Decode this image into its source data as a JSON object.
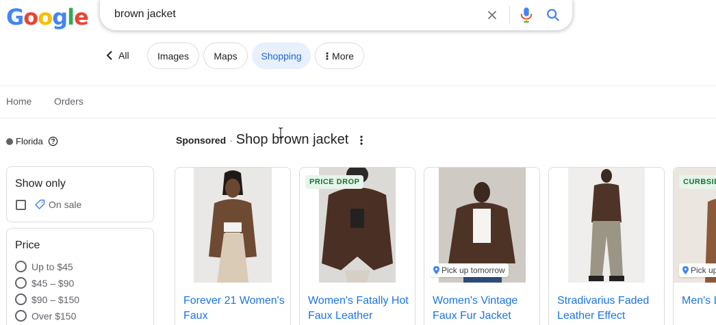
{
  "logo": {
    "letters": [
      "G",
      "o",
      "o",
      "g",
      "l",
      "e"
    ],
    "colors": [
      "#4285f4",
      "#ea4335",
      "#fbbc05",
      "#4285f4",
      "#34a853",
      "#ea4335"
    ]
  },
  "search": {
    "query": "brown jacket"
  },
  "chips": {
    "back_label": "All",
    "items": [
      {
        "label": "Images"
      },
      {
        "label": "Maps"
      },
      {
        "label": "Shopping",
        "active": true
      },
      {
        "label": "More"
      }
    ]
  },
  "nav": {
    "home": "Home",
    "orders": "Orders"
  },
  "location": {
    "label": "Florida"
  },
  "filters": {
    "show_only": {
      "title": "Show only",
      "option": "On sale"
    },
    "price": {
      "title": "Price",
      "options": [
        "Up to $45",
        "$45 – $90",
        "$90 – $150",
        "Over $150"
      ]
    }
  },
  "results": {
    "sponsored_label": "Sponsored",
    "separator": "·",
    "heading": "Shop brown jacket",
    "products": [
      {
        "title": "Forever 21 Women's Faux",
        "badge": "",
        "pickup": ""
      },
      {
        "title": "Women's Fatally Hot Faux Leather",
        "badge": "PRICE DROP",
        "pickup": ""
      },
      {
        "title": "Women's Vintage Faux Fur Jacket",
        "badge": "",
        "pickup": "Pick up tomorrow"
      },
      {
        "title": "Stradivarius Faded Leather Effect",
        "badge": "",
        "pickup": ""
      },
      {
        "title": "Men's L Bombe",
        "badge": "CURBSID",
        "pickup": "Pick up"
      }
    ]
  },
  "colors": {
    "accent": "#1a73e8",
    "chip_active_bg": "#e8f0fe",
    "badge_bg": "#e6f4ea",
    "badge_text": "#137333"
  }
}
